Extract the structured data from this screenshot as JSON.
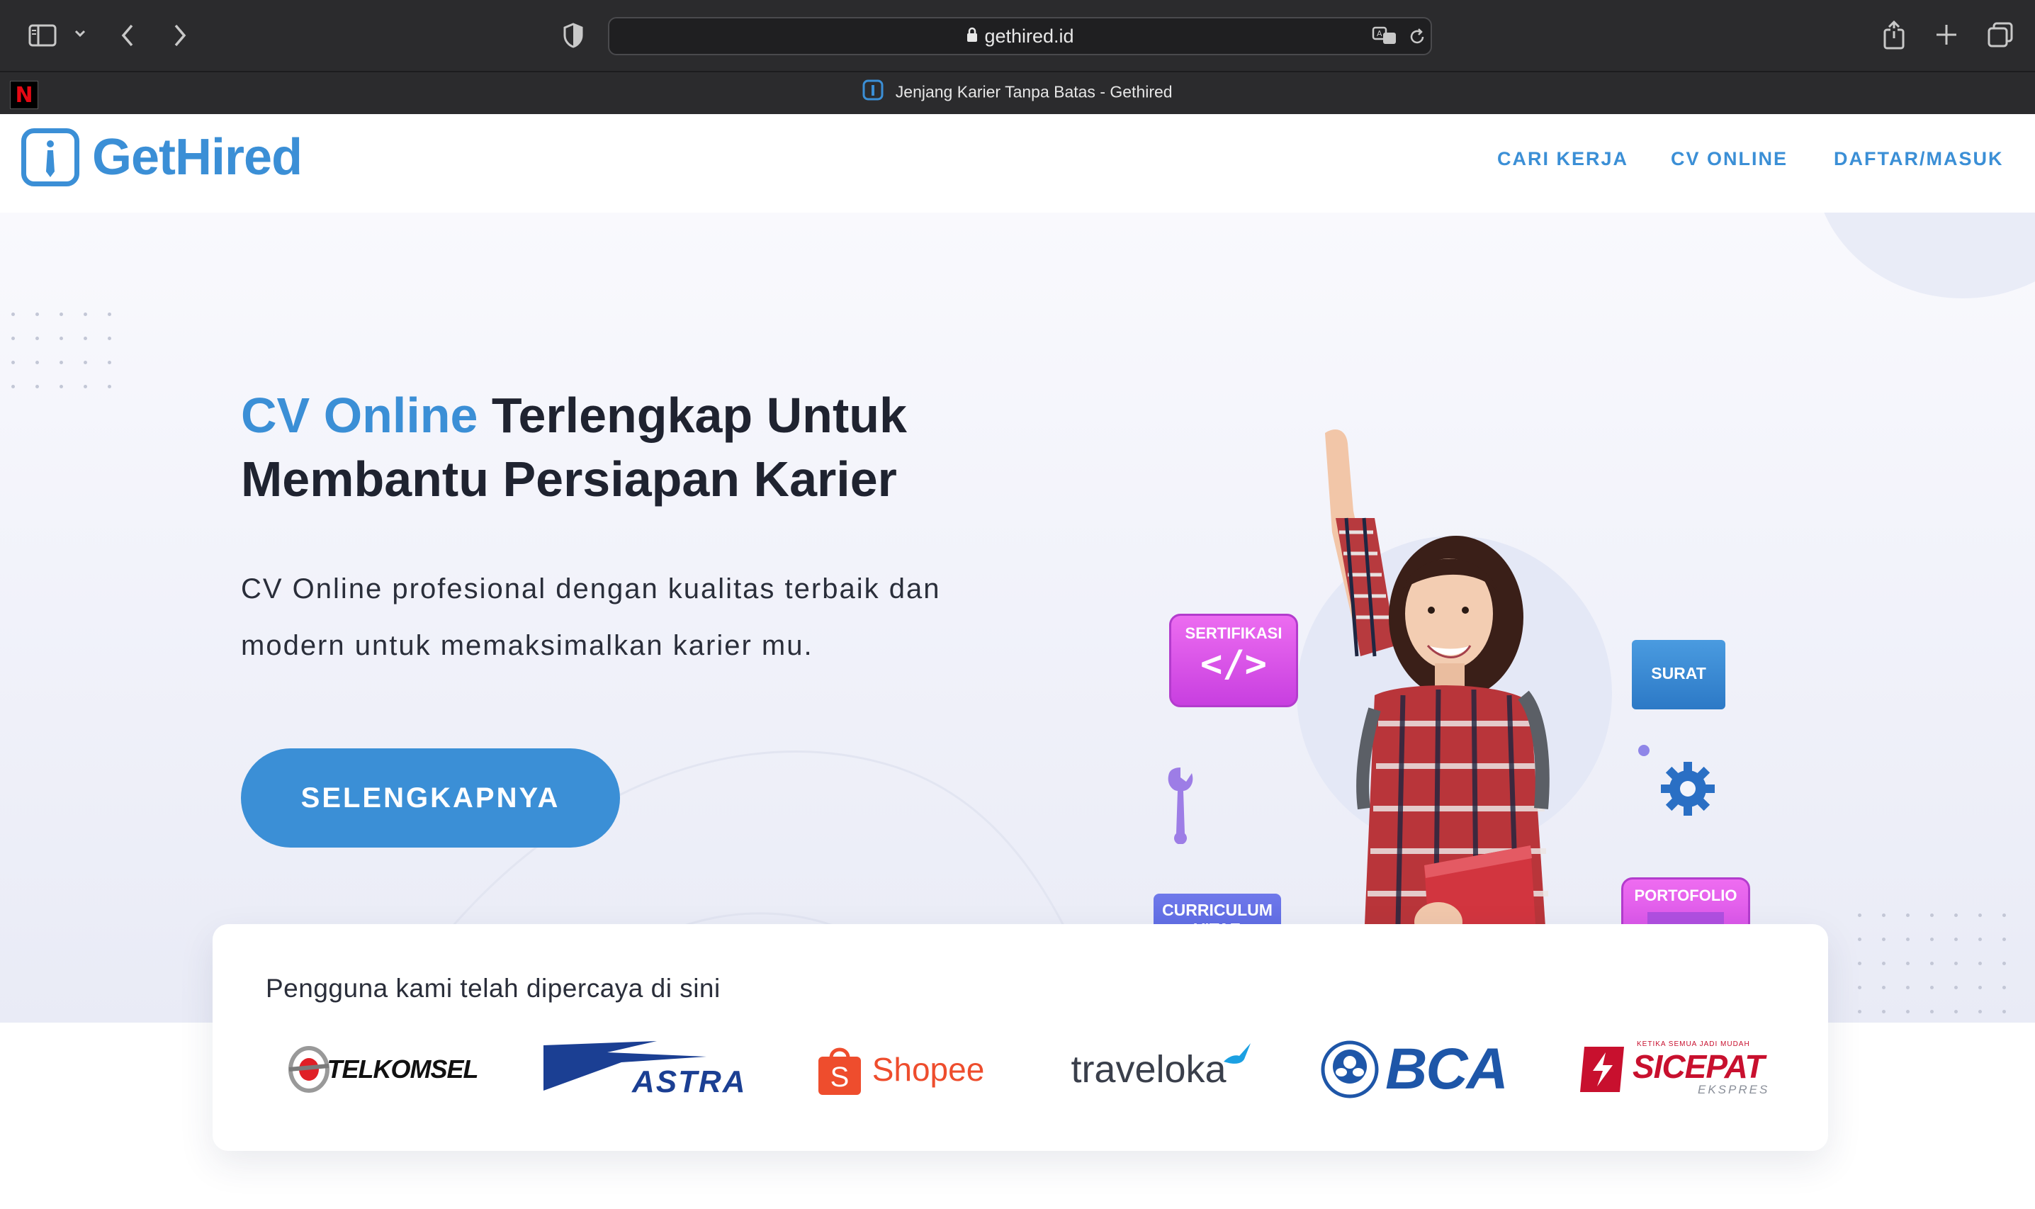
{
  "browser": {
    "url": "gethired.id",
    "tab_title": "Jenjang Karier Tanpa Batas - Gethired",
    "pinned_tab_letter": "N"
  },
  "nav": {
    "logo_text": "GetHired",
    "links": [
      "CARI KERJA",
      "CV ONLINE",
      "DAFTAR/MASUK"
    ]
  },
  "hero": {
    "headline_accent": "CV Online",
    "headline_rest_line1": " Terlengkap Untuk",
    "headline_line2": "Membantu Persiapan Karier",
    "subtext_line1": "CV Online profesional dengan kualitas terbaik dan",
    "subtext_line2": "modern untuk memaksimalkan karier mu.",
    "cta_label": "SELENGKAPNYA",
    "illustration_cards": {
      "sertifikasi": "SERTIFIKASI",
      "surat": "SURAT",
      "cv_line1": "CURRICULUM",
      "cv_line2": "VITAE",
      "portofolio": "PORTOFOLIO"
    }
  },
  "trust": {
    "title": "Pengguna kami telah dipercaya di sini",
    "brands": [
      "TELKOMSEL",
      "ASTRA",
      "Shopee",
      "traveloka",
      "BCA",
      "SICEPAT"
    ],
    "sicepat_tagline": "KETIKA SEMUA JADI MUDAH",
    "sicepat_sub": "EKSPRES"
  },
  "colors": {
    "brand_blue": "#3b8fd6",
    "dark_text": "#1f2330"
  }
}
